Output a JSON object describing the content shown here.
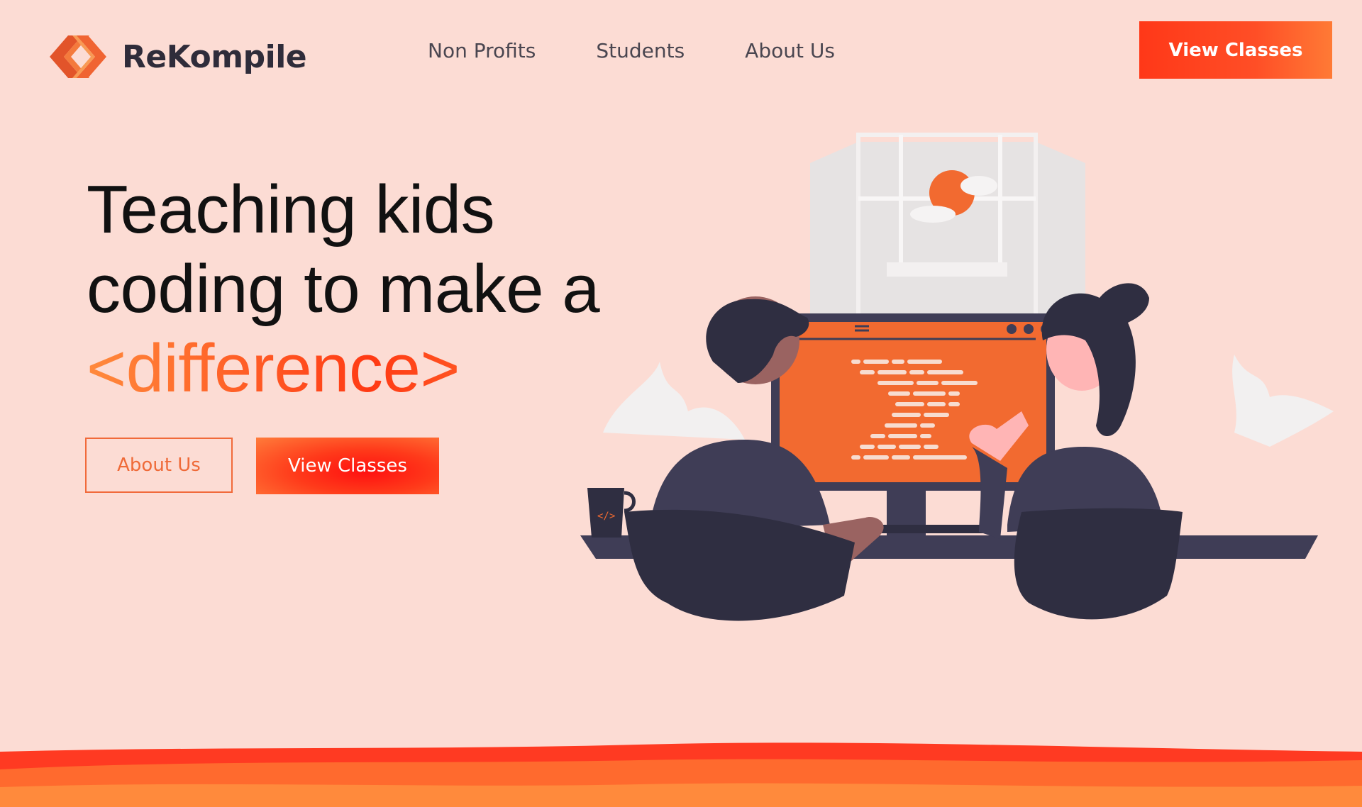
{
  "brand": {
    "name": "ReKompile",
    "logo_icon": "code-brackets-logo",
    "accent": "#ff4a1f"
  },
  "nav": {
    "items": [
      "Non Profits",
      "Students",
      "About Us"
    ]
  },
  "header": {
    "cta_label": "View Classes"
  },
  "hero": {
    "title_line1": "Teaching kids",
    "title_line2": "coding to make a",
    "title_accent": "<difference>"
  },
  "buttons": {
    "about_label": "About Us",
    "classes_label": "View Classes"
  },
  "illustration": {
    "mug_glyph": "</>"
  },
  "colors": {
    "background": "#fcdcd4",
    "dark": "#2f2c3a",
    "orange": "#f26a30"
  }
}
